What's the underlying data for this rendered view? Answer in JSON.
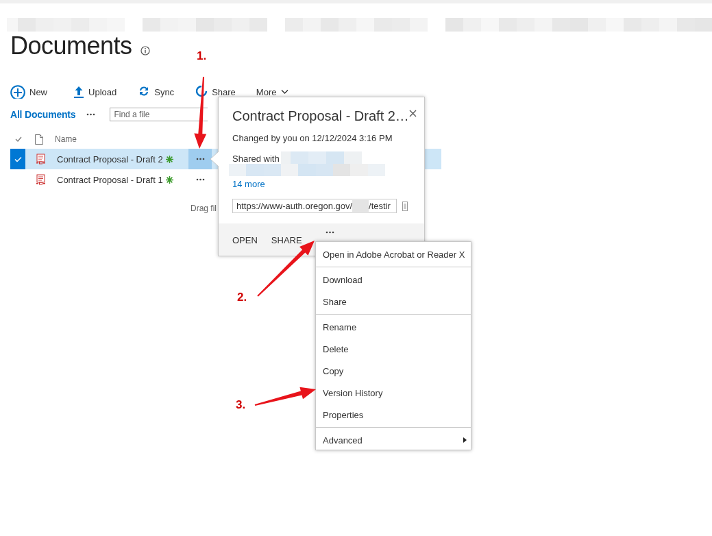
{
  "page": {
    "title": "Documents"
  },
  "toolbar": [
    {
      "kind": "new",
      "label": "New"
    },
    {
      "kind": "upload",
      "label": "Upload"
    },
    {
      "kind": "sync",
      "label": "Sync"
    },
    {
      "kind": "share",
      "label": "Share"
    },
    {
      "kind": "more",
      "label": "More"
    }
  ],
  "view": {
    "label": "All Documents",
    "search_placeholder": "Find a file"
  },
  "table": {
    "columns": [
      "Name"
    ],
    "rows": [
      {
        "name": "Contract Proposal - Draft 2",
        "selected": true,
        "new": true
      },
      {
        "name": "Contract Proposal - Draft 1",
        "selected": false,
        "new": true
      }
    ],
    "drop_hint": "Drag fil"
  },
  "callout": {
    "title": "Contract Proposal - Draft 2…",
    "changed": "Changed by you on 12/12/2024 3:16 PM",
    "shared_label": "Shared with",
    "more_link": "14 more",
    "url_start": "https://www-auth.oregon.gov/",
    "url_end": "/testir",
    "actions": [
      "OPEN",
      "SHARE"
    ]
  },
  "menu": {
    "groups": [
      [
        {
          "label": "Open in Adobe Acrobat or Reader X",
          "submenu": false
        }
      ],
      [
        {
          "label": "Download",
          "submenu": false
        },
        {
          "label": "Share",
          "submenu": false
        }
      ],
      [
        {
          "label": "Rename",
          "submenu": false
        },
        {
          "label": "Delete",
          "submenu": false
        },
        {
          "label": "Copy",
          "submenu": false
        },
        {
          "label": "Version History",
          "submenu": false
        },
        {
          "label": "Properties",
          "submenu": false
        }
      ],
      [
        {
          "label": "Advanced",
          "submenu": true
        }
      ]
    ]
  },
  "annotations": [
    {
      "label": "1."
    },
    {
      "label": "2."
    },
    {
      "label": "3."
    }
  ]
}
